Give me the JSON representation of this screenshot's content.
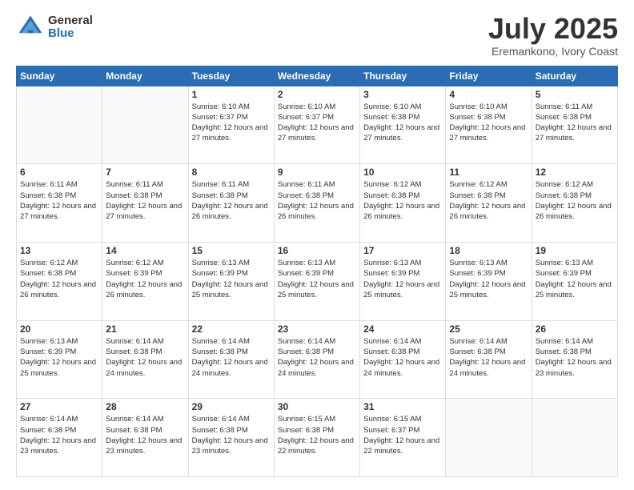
{
  "logo": {
    "general": "General",
    "blue": "Blue"
  },
  "header": {
    "month": "July 2025",
    "location": "Eremankono, Ivory Coast"
  },
  "weekdays": [
    "Sunday",
    "Monday",
    "Tuesday",
    "Wednesday",
    "Thursday",
    "Friday",
    "Saturday"
  ],
  "weeks": [
    [
      {
        "day": "",
        "info": ""
      },
      {
        "day": "",
        "info": ""
      },
      {
        "day": "1",
        "info": "Sunrise: 6:10 AM\nSunset: 6:37 PM\nDaylight: 12 hours and 27 minutes."
      },
      {
        "day": "2",
        "info": "Sunrise: 6:10 AM\nSunset: 6:37 PM\nDaylight: 12 hours and 27 minutes."
      },
      {
        "day": "3",
        "info": "Sunrise: 6:10 AM\nSunset: 6:38 PM\nDaylight: 12 hours and 27 minutes."
      },
      {
        "day": "4",
        "info": "Sunrise: 6:10 AM\nSunset: 6:38 PM\nDaylight: 12 hours and 27 minutes."
      },
      {
        "day": "5",
        "info": "Sunrise: 6:11 AM\nSunset: 6:38 PM\nDaylight: 12 hours and 27 minutes."
      }
    ],
    [
      {
        "day": "6",
        "info": "Sunrise: 6:11 AM\nSunset: 6:38 PM\nDaylight: 12 hours and 27 minutes."
      },
      {
        "day": "7",
        "info": "Sunrise: 6:11 AM\nSunset: 6:38 PM\nDaylight: 12 hours and 27 minutes."
      },
      {
        "day": "8",
        "info": "Sunrise: 6:11 AM\nSunset: 6:38 PM\nDaylight: 12 hours and 26 minutes."
      },
      {
        "day": "9",
        "info": "Sunrise: 6:11 AM\nSunset: 6:38 PM\nDaylight: 12 hours and 26 minutes."
      },
      {
        "day": "10",
        "info": "Sunrise: 6:12 AM\nSunset: 6:38 PM\nDaylight: 12 hours and 26 minutes."
      },
      {
        "day": "11",
        "info": "Sunrise: 6:12 AM\nSunset: 6:38 PM\nDaylight: 12 hours and 26 minutes."
      },
      {
        "day": "12",
        "info": "Sunrise: 6:12 AM\nSunset: 6:38 PM\nDaylight: 12 hours and 26 minutes."
      }
    ],
    [
      {
        "day": "13",
        "info": "Sunrise: 6:12 AM\nSunset: 6:38 PM\nDaylight: 12 hours and 26 minutes."
      },
      {
        "day": "14",
        "info": "Sunrise: 6:12 AM\nSunset: 6:39 PM\nDaylight: 12 hours and 26 minutes."
      },
      {
        "day": "15",
        "info": "Sunrise: 6:13 AM\nSunset: 6:39 PM\nDaylight: 12 hours and 25 minutes."
      },
      {
        "day": "16",
        "info": "Sunrise: 6:13 AM\nSunset: 6:39 PM\nDaylight: 12 hours and 25 minutes."
      },
      {
        "day": "17",
        "info": "Sunrise: 6:13 AM\nSunset: 6:39 PM\nDaylight: 12 hours and 25 minutes."
      },
      {
        "day": "18",
        "info": "Sunrise: 6:13 AM\nSunset: 6:39 PM\nDaylight: 12 hours and 25 minutes."
      },
      {
        "day": "19",
        "info": "Sunrise: 6:13 AM\nSunset: 6:39 PM\nDaylight: 12 hours and 25 minutes."
      }
    ],
    [
      {
        "day": "20",
        "info": "Sunrise: 6:13 AM\nSunset: 6:39 PM\nDaylight: 12 hours and 25 minutes."
      },
      {
        "day": "21",
        "info": "Sunrise: 6:14 AM\nSunset: 6:38 PM\nDaylight: 12 hours and 24 minutes."
      },
      {
        "day": "22",
        "info": "Sunrise: 6:14 AM\nSunset: 6:38 PM\nDaylight: 12 hours and 24 minutes."
      },
      {
        "day": "23",
        "info": "Sunrise: 6:14 AM\nSunset: 6:38 PM\nDaylight: 12 hours and 24 minutes."
      },
      {
        "day": "24",
        "info": "Sunrise: 6:14 AM\nSunset: 6:38 PM\nDaylight: 12 hours and 24 minutes."
      },
      {
        "day": "25",
        "info": "Sunrise: 6:14 AM\nSunset: 6:38 PM\nDaylight: 12 hours and 24 minutes."
      },
      {
        "day": "26",
        "info": "Sunrise: 6:14 AM\nSunset: 6:38 PM\nDaylight: 12 hours and 23 minutes."
      }
    ],
    [
      {
        "day": "27",
        "info": "Sunrise: 6:14 AM\nSunset: 6:38 PM\nDaylight: 12 hours and 23 minutes."
      },
      {
        "day": "28",
        "info": "Sunrise: 6:14 AM\nSunset: 6:38 PM\nDaylight: 12 hours and 23 minutes."
      },
      {
        "day": "29",
        "info": "Sunrise: 6:14 AM\nSunset: 6:38 PM\nDaylight: 12 hours and 23 minutes."
      },
      {
        "day": "30",
        "info": "Sunrise: 6:15 AM\nSunset: 6:38 PM\nDaylight: 12 hours and 22 minutes."
      },
      {
        "day": "31",
        "info": "Sunrise: 6:15 AM\nSunset: 6:37 PM\nDaylight: 12 hours and 22 minutes."
      },
      {
        "day": "",
        "info": ""
      },
      {
        "day": "",
        "info": ""
      }
    ]
  ]
}
